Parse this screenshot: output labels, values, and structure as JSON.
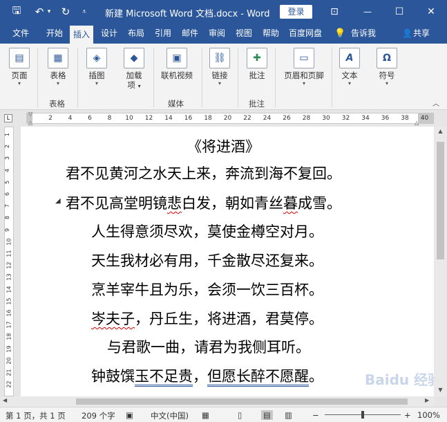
{
  "titlebar": {
    "title": "新建 Microsoft Word 文档.docx  -  Word",
    "login_label": "登录",
    "save_glyph": "🖫",
    "undo_glyph": "↶",
    "undo_caret": "▾",
    "redo_glyph": "↻",
    "customize_glyph": "⩡",
    "ribbon_display_glyph": "⊡",
    "minimize_glyph": "—",
    "maximize_glyph": "☐",
    "close_glyph": "✕"
  },
  "tabs": [
    "文件",
    "开始",
    "插入",
    "设计",
    "布局",
    "引用",
    "邮件",
    "审阅",
    "视图",
    "帮助",
    "百度网盘"
  ],
  "active_tab": "插入",
  "tell_me": {
    "glyph": "💡",
    "label": "告诉我"
  },
  "share": {
    "glyph": "👤",
    "label": "共享"
  },
  "ribbon": {
    "page": {
      "label": "页面",
      "glyph": "▤",
      "caret": "▾"
    },
    "table": {
      "label": "表格",
      "glyph": "▦",
      "caret": "▾"
    },
    "illustrations": {
      "label": "插图",
      "glyph": "◈",
      "caret": "▾"
    },
    "addins": {
      "label1": "加载",
      "label2": "项",
      "glyph": "◆",
      "caret": "▾"
    },
    "online_video": {
      "label": "联机视频",
      "glyph": "▣"
    },
    "links": {
      "label": "链接",
      "glyph": "⛓",
      "caret": "▾"
    },
    "comment": {
      "label": "批注",
      "glyph": "✚"
    },
    "header_footer": {
      "label": "页眉和页脚",
      "glyph": "▭",
      "caret": "▾"
    },
    "text": {
      "label": "文本",
      "glyph": "A",
      "caret": "▾"
    },
    "symbols": {
      "label": "符号",
      "glyph": "Ω",
      "caret": "▾"
    },
    "groups": {
      "table": "表格",
      "media": "媒体",
      "comments": "批注"
    },
    "collapse_glyph": "︿"
  },
  "ruler": {
    "corner_glyph": "L",
    "ticks": [
      "2",
      "4",
      "6",
      "8",
      "10",
      "12",
      "14",
      "16",
      "18",
      "20",
      "22",
      "24",
      "26",
      "28",
      "30",
      "32",
      "34",
      "36",
      "38",
      "40"
    ],
    "vticks": [
      "1",
      "2",
      "3",
      "4",
      "5",
      "6",
      "7",
      "8",
      "9",
      "10",
      "11",
      "12",
      "13",
      "14",
      "15",
      "16",
      "17",
      "18",
      "19",
      "20",
      "21",
      "22"
    ]
  },
  "document": {
    "lines": [
      "《将进酒》",
      "君不见黄河之水天上来，奔流到海不复回。",
      "君不见高堂明镜悲白发，朝如青丝暮成雪。",
      "人生得意须尽欢，莫使金樽空对月。",
      "天生我材必有用，千金散尽还复来。",
      "烹羊宰牛且为乐，会须一饮三百杯。",
      "岑夫子，丹丘生，将进酒，君莫停。",
      "与君歌一曲，请君为我侧耳听。",
      "钟鼓馔玉不足贵，但愿长醉不愿醒。"
    ],
    "line3_parts": [
      "君不见高堂明镜",
      "悲",
      "白发，朝如青丝",
      "暮",
      "成雪。"
    ],
    "line7_parts": [
      "岑夫子",
      "，丹丘生，将进酒，君莫停。"
    ],
    "line9_parts": [
      "钟鼓馔",
      "玉不足贵",
      "，",
      "但愿长醉不愿醒",
      "。"
    ],
    "para_mark": "◢"
  },
  "statusbar": {
    "page": "第 1 页，共 1 页",
    "words": "209 个字",
    "proof_glyph": "▣",
    "language": "中文(中国)",
    "macro_glyph": "▦",
    "view_read_glyph": "▯",
    "view_print_glyph": "▤",
    "view_web_glyph": "▥",
    "zoom_out": "−",
    "zoom_in": "+",
    "zoom": "100%",
    "zoom_level": 0.5
  },
  "watermark": "Baidu 经验"
}
